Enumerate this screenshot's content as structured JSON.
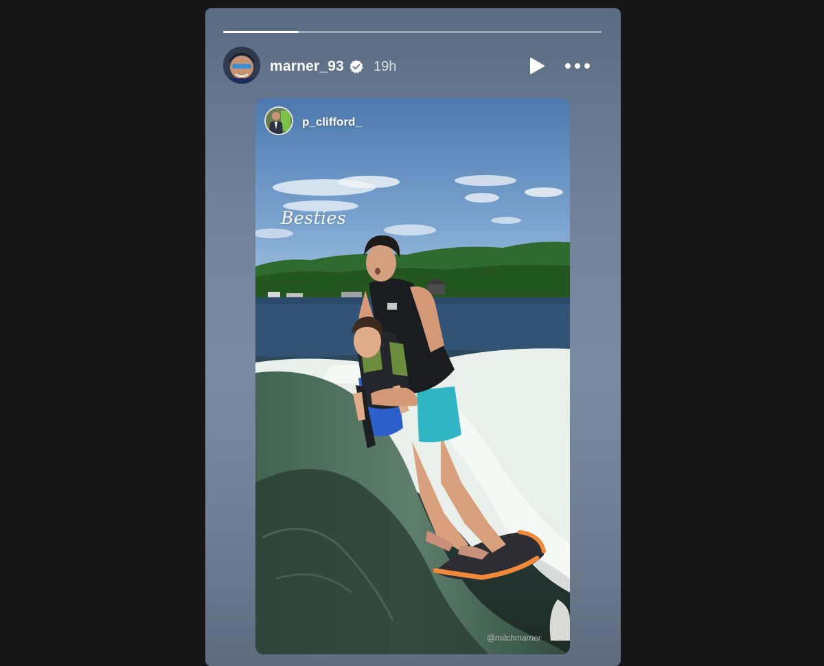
{
  "story": {
    "progress": 0.2,
    "author": {
      "username": "marner_93",
      "verified": true,
      "posted_ago": "19h",
      "avatar_icon": "profile-avatar"
    },
    "controls": {
      "play_icon": "play-icon",
      "more_icon": "more-options-icon"
    },
    "shared_post": {
      "username": "p_clifford_",
      "caption": "Besties",
      "watermark": "@mitchmarner"
    }
  },
  "colors": {
    "background": "#161616",
    "story_panel": "#71819a",
    "verified_badge": "#ffffff",
    "text": "#ffffff"
  }
}
